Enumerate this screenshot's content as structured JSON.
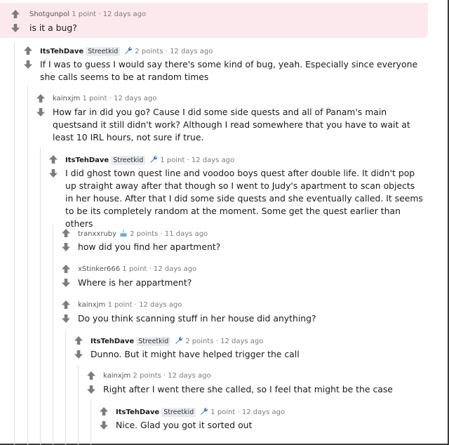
{
  "colors": {
    "highlight": "#fce9ee",
    "arrow": "#7c7c7c",
    "wrench": "#2f80d1",
    "cake": "#5aa9e6"
  },
  "icons": {
    "upvote": "arrow-up-icon",
    "downvote": "arrow-down-icon",
    "moderator": "wrench-icon",
    "cake_day": "cake-icon"
  },
  "comments": [
    {
      "user": "Shotgunpol",
      "points": "1 point",
      "age": "12 days ago",
      "text": "is it a bug?",
      "highlighted": true
    },
    {
      "user": "ItsTehDave",
      "flair": "Streetkid",
      "points": "2 points",
      "age": "12 days ago",
      "text": "If I was to guess I would say there's some kind of bug, yeah. Especially since everyone she calls seems to be at random times"
    },
    {
      "user": "kainxjm",
      "points": "1 point",
      "age": "12 days ago",
      "text": "How far in did you go? Cause I did some side quests and all of Panam's main questsand it still didn't work? Although I read somewhere that you have to wait at least 10 IRL hours, not sure if true."
    },
    {
      "user": "ItsTehDave",
      "flair": "Streetkid",
      "points": "1 point",
      "age": "12 days ago",
      "text": "I did ghost town quest line and voodoo boys quest after double life. It didn't pop up straight away after that though so I went to Judy's apartment to scan objects in her house. After that I did some side quests and she eventually called. It seems to be its completely random at the moment. Some get the quest earlier than others"
    },
    {
      "user": "tranxxruby",
      "points": "2 points",
      "age": "11 days ago",
      "text": "how did you find her apartment?"
    },
    {
      "user": "xStinker666",
      "points": "1 point",
      "age": "12 days ago",
      "text": "Where is her appartment?"
    },
    {
      "user": "kainxjm",
      "points": "1 point",
      "age": "12 days ago",
      "text": "Do you think scanning stuff in her house did anything?"
    },
    {
      "user": "ItsTehDave",
      "flair": "Streetkid",
      "points": "2 points",
      "age": "12 days ago",
      "text": "Dunno. But it might have helped trigger the call"
    },
    {
      "user": "kainxjm",
      "points": "2 points",
      "age": "12 days ago",
      "text": "Right after I went there she called, so I feel that might be the case"
    },
    {
      "user": "ItsTehDave",
      "flair": "Streetkid",
      "points": "1 point",
      "age": "12 days ago",
      "text": "Nice. Glad you got it sorted out"
    }
  ]
}
